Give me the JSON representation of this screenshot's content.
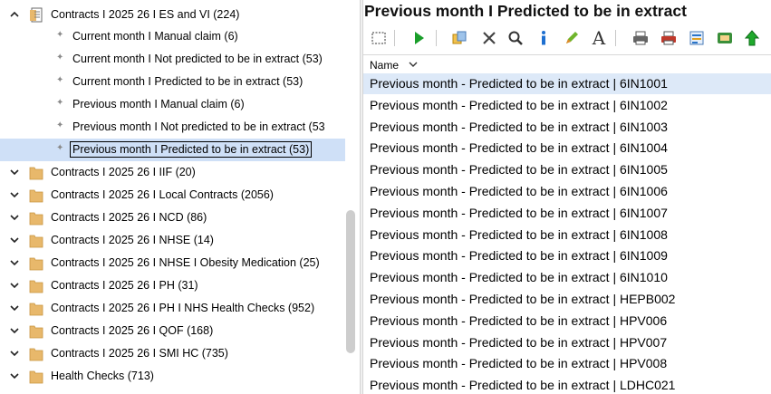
{
  "tree": {
    "expanded_folder": "Contracts I 2025 26 I ES and VI (224)",
    "children": [
      "Current month I Manual claim (6)",
      "Current month I Not predicted to be in extract (53)",
      "Current month I Predicted to be in extract (53)",
      "Previous month I Manual claim (6)",
      "Previous month I Not predicted to be in extract (53",
      "Previous month I Predicted to be in extract (53)"
    ],
    "selected_child_index": 5,
    "collapsed_folders": [
      "Contracts I 2025 26 I IIF (20)",
      "Contracts I 2025 26 I Local Contracts (2056)",
      "Contracts I 2025 26 I NCD (86)",
      "Contracts I 2025 26 I NHSE (14)",
      "Contracts I 2025 26 I NHSE I Obesity Medication (25)",
      "Contracts I 2025 26 I PH (31)",
      "Contracts I 2025 26 I PH I NHS Health Checks (952)",
      "Contracts I 2025 26 I QOF (168)",
      "Contracts I 2025 26 I SMI HC (735)",
      "Health Checks (713)"
    ]
  },
  "panel": {
    "title": "Previous month I Predicted to be in extract",
    "column_header": "Name",
    "toolbar_icons": [
      "select-all-icon",
      "run-icon",
      "copy-icon",
      "delete-icon",
      "search-icon",
      "info-icon",
      "edit-icon",
      "font-icon",
      "print-icon",
      "print-preview-icon",
      "report-icon",
      "export-icon",
      "upload-icon"
    ],
    "rows": [
      "Previous month - Predicted to be in extract | 6IN1001",
      "Previous month - Predicted to be in extract | 6IN1002",
      "Previous month - Predicted to be in extract | 6IN1003",
      "Previous month - Predicted to be in extract | 6IN1004",
      "Previous month - Predicted to be in extract | 6IN1005",
      "Previous month - Predicted to be in extract | 6IN1006",
      "Previous month - Predicted to be in extract | 6IN1007",
      "Previous month - Predicted to be in extract | 6IN1008",
      "Previous month - Predicted to be in extract | 6IN1009",
      "Previous month - Predicted to be in extract | 6IN1010",
      "Previous month - Predicted to be in extract | HEPB002",
      "Previous month - Predicted to be in extract | HPV006",
      "Previous month - Predicted to be in extract | HPV007",
      "Previous month - Predicted to be in extract | HPV008",
      "Previous month - Predicted to be in extract | LDHC021"
    ],
    "selected_row_index": 0
  },
  "colors": {
    "selection": "#cfe0f7",
    "folder": "#e8b86b",
    "run_green": "#1a9e2a"
  }
}
